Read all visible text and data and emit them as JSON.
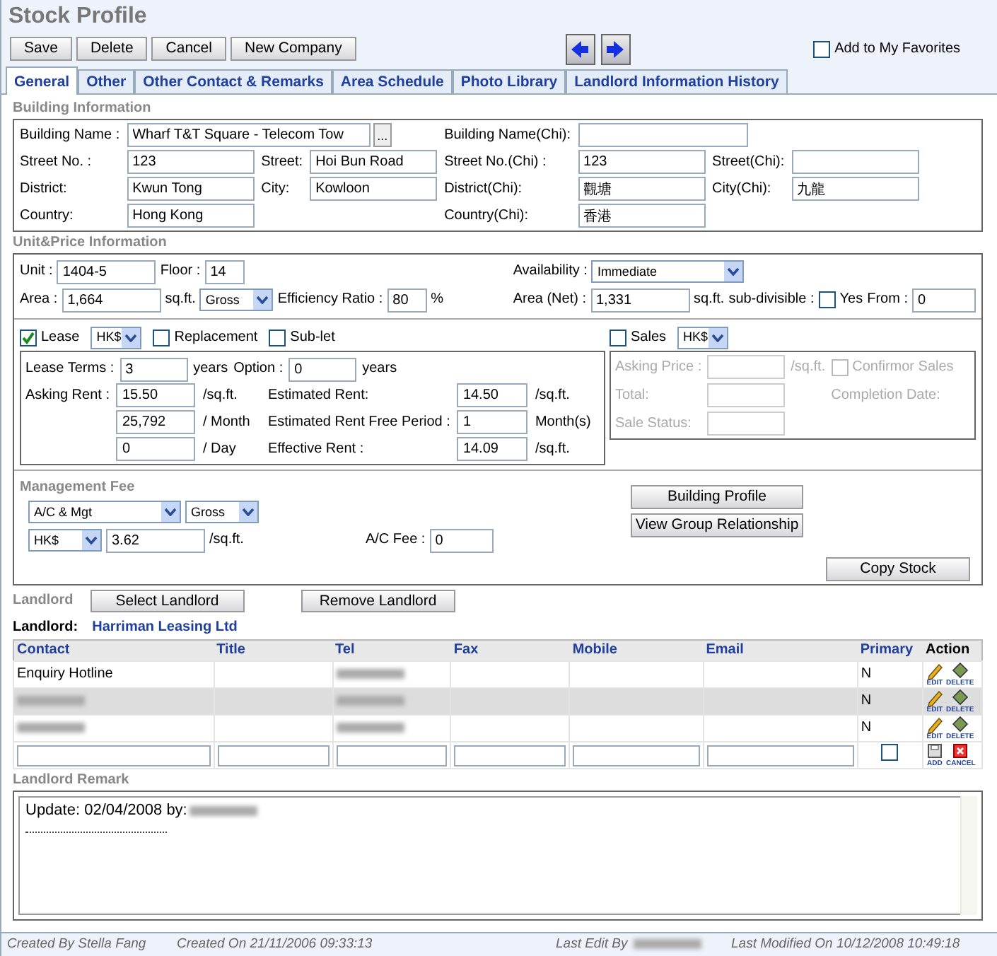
{
  "title": "Stock Profile",
  "toolbar": {
    "buttons": [
      "Save",
      "Delete",
      "Cancel",
      "New Company"
    ],
    "favorite": {
      "label": "Add to My Favorites",
      "checked": false
    }
  },
  "tabs": [
    {
      "label": "General",
      "selected": true
    },
    {
      "label": "Other",
      "selected": false
    },
    {
      "label": "Other Contact & Remarks",
      "selected": false
    },
    {
      "label": "Area Schedule",
      "selected": false
    },
    {
      "label": "Photo Library",
      "selected": false
    },
    {
      "label": "Landlord Information History",
      "selected": false
    }
  ],
  "building": {
    "title": "Building Information",
    "rows": [
      [
        {
          "kind": "browse",
          "label": "Building Name :",
          "value": "Wharf T&T Square - Telecom Tow",
          "button": "..."
        },
        {
          "kind": "gap"
        },
        {
          "kind": "wide",
          "label": "Building Name(Chi):"
        }
      ],
      [
        {
          "kind": "field",
          "label": "Street No. :",
          "value": "123"
        },
        {
          "kind": "field",
          "label": "Street:",
          "value": "Hoi Bun Road"
        },
        {
          "kind": "field",
          "label": "Street No.(Chi) :",
          "value": "123"
        },
        {
          "kind": "field",
          "label": "Street(Chi):"
        }
      ],
      [
        {
          "kind": "field",
          "label": "District:",
          "value": "Kwun Tong"
        },
        {
          "kind": "field",
          "label": "City:",
          "value": "Kowloon"
        },
        {
          "kind": "field",
          "label": "District(Chi):",
          "value": "觀塘"
        },
        {
          "kind": "field",
          "label": "City(Chi):",
          "value": "九龍"
        }
      ],
      [
        {
          "kind": "field",
          "label": "Country:",
          "value": "Hong Kong"
        },
        {
          "kind": "gap"
        },
        {
          "kind": "field",
          "label": "Country(Chi):",
          "value": "香港"
        }
      ]
    ]
  },
  "unit_price": {
    "title": "Unit&Price Information",
    "left": [
      [
        {
          "kind": "label",
          "text": "Unit :"
        },
        {
          "kind": "input",
          "value": "1404-5"
        },
        {
          "kind": "label",
          "text": "Floor :"
        },
        {
          "kind": "short-input",
          "value": "14"
        }
      ],
      [
        {
          "kind": "label",
          "text": "Area :"
        },
        {
          "kind": "input",
          "value": "1,664"
        },
        {
          "kind": "label",
          "text": "sq.ft."
        },
        {
          "kind": "select",
          "value": "Gross"
        },
        {
          "kind": "label",
          "text": "Efficiency Ratio :"
        },
        {
          "kind": "short-input",
          "value": "80"
        },
        {
          "kind": "label",
          "text": "%"
        }
      ]
    ],
    "right": [
      [
        {
          "kind": "label",
          "text": "Availability :"
        },
        {
          "kind": "wide-select",
          "value": "Immediate"
        }
      ],
      [
        {
          "kind": "label",
          "text": "Area (Net) :"
        },
        {
          "kind": "input",
          "value": "1,331"
        },
        {
          "kind": "label",
          "text": "sq.ft."
        },
        {
          "kind": "label",
          "text": "sub-divisible :"
        },
        {
          "kind": "check",
          "label": "Yes",
          "checked": false
        },
        {
          "kind": "label",
          "text": "From :"
        },
        {
          "kind": "mid-input",
          "value": "0"
        }
      ]
    ]
  },
  "lease": {
    "header": [
      {
        "kind": "check",
        "label": "Lease",
        "checked": true
      },
      {
        "kind": "small-select",
        "value": "HK$"
      },
      {
        "kind": "check",
        "label": "Replacement",
        "checked": false
      },
      {
        "kind": "check",
        "label": "Sub-let",
        "checked": false
      }
    ],
    "terms": [
      {
        "kind": "label",
        "text": "Lease Terms :"
      },
      {
        "kind": "short-input",
        "value": "3"
      },
      {
        "kind": "label",
        "text": "years"
      },
      {
        "kind": "label",
        "text": "Option :"
      },
      {
        "kind": "short-input",
        "value": "0"
      },
      {
        "kind": "label",
        "text": "years"
      }
    ],
    "left": [
      [
        {
          "kind": "label",
          "text": "Asking Rent :"
        },
        {
          "kind": "input",
          "value": "15.50"
        },
        {
          "kind": "label",
          "text": "/sq.ft."
        }
      ],
      [
        {
          "kind": "blank"
        },
        {
          "kind": "input",
          "value": "25,792"
        },
        {
          "kind": "label",
          "text": "/ Month"
        }
      ],
      [
        {
          "kind": "blank"
        },
        {
          "kind": "input",
          "value": "0"
        },
        {
          "kind": "label",
          "text": "/ Day"
        }
      ]
    ],
    "right": [
      [
        {
          "kind": "label",
          "text": "Estimated Rent:"
        },
        {
          "kind": "input",
          "value": "14.50"
        },
        {
          "kind": "label",
          "text": "/sq.ft."
        }
      ],
      [
        {
          "kind": "label",
          "text": "Estimated Rent Free Period :"
        },
        {
          "kind": "input",
          "value": "1"
        },
        {
          "kind": "label",
          "text": "Month(s)"
        }
      ],
      [
        {
          "kind": "label",
          "text": "Effective Rent :"
        },
        {
          "kind": "input",
          "value": "14.09"
        },
        {
          "kind": "label",
          "text": "/sq.ft."
        }
      ]
    ]
  },
  "sales": {
    "disabled": true,
    "header": [
      {
        "kind": "check",
        "label": "Sales",
        "checked": false
      },
      {
        "kind": "small-select",
        "value": "HK$"
      }
    ],
    "rows": [
      [
        {
          "kind": "label",
          "text": "Asking Price :"
        },
        {
          "kind": "input"
        },
        {
          "kind": "label",
          "text": "/sq.ft."
        },
        {
          "kind": "check",
          "label": "Confirmor Sales",
          "checked": false
        }
      ],
      [
        {
          "kind": "label",
          "text": "Total:"
        },
        {
          "kind": "input"
        },
        {
          "kind": "blank"
        },
        {
          "kind": "label",
          "text": "Completion Date:"
        }
      ],
      [
        {
          "kind": "label",
          "text": "Sale Status:"
        },
        {
          "kind": "input"
        }
      ]
    ]
  },
  "management": {
    "title": "Management Fee",
    "lines": [
      [
        {
          "kind": "wide-select",
          "value": "A/C & Mgt"
        },
        {
          "kind": "select",
          "value": "Gross"
        }
      ],
      [
        {
          "kind": "select",
          "value": "HK$"
        },
        {
          "kind": "input",
          "value": "3.62"
        },
        {
          "kind": "label",
          "text": "/sq.ft."
        },
        {
          "kind": "gap"
        },
        {
          "kind": "label",
          "text": "A/C Fee :"
        },
        {
          "kind": "mid-input",
          "value": "0"
        }
      ]
    ],
    "buttons": [
      "Building Profile",
      "View Group Relationship"
    ],
    "copy_button": "Copy Stock"
  },
  "landlord": {
    "label": "Landlord",
    "buttons": [
      "Select Landlord",
      "Remove Landlord"
    ],
    "name_label": "Landlord:",
    "name": "Harriman Leasing Ltd",
    "columns": [
      "Contact",
      "Title",
      "Tel",
      "Fax",
      "Mobile",
      "Email",
      "Primary",
      "Action"
    ],
    "rows": [
      {
        "contact": "Enquiry Hotline",
        "contact_redacted": false,
        "tel_redacted": true,
        "primary": "N",
        "selected": false,
        "actions": [
          "EDIT",
          "DELETE"
        ]
      },
      {
        "contact_redacted": true,
        "tel_redacted": true,
        "primary": "N",
        "selected": true,
        "actions": [
          "EDIT",
          "DELETE"
        ]
      },
      {
        "contact_redacted": true,
        "tel_redacted": true,
        "primary": "N",
        "selected": false,
        "actions": [
          "EDIT",
          "DELETE"
        ]
      }
    ],
    "new_row": {
      "primary_checked": false,
      "actions": [
        "ADD",
        "CANCEL"
      ]
    }
  },
  "remark": {
    "title": "Landlord Remark",
    "text": "Update: 02/04/2008 by:",
    "author_redacted": true
  },
  "footer": {
    "created_by": "Created By Stella Fang",
    "created_on": "Created On 21/11/2006 09:33:13",
    "last_edit_by": "Last Edit By",
    "last_edit_redacted": true,
    "last_modified": "Last Modified On 10/12/2008 10:49:18"
  }
}
